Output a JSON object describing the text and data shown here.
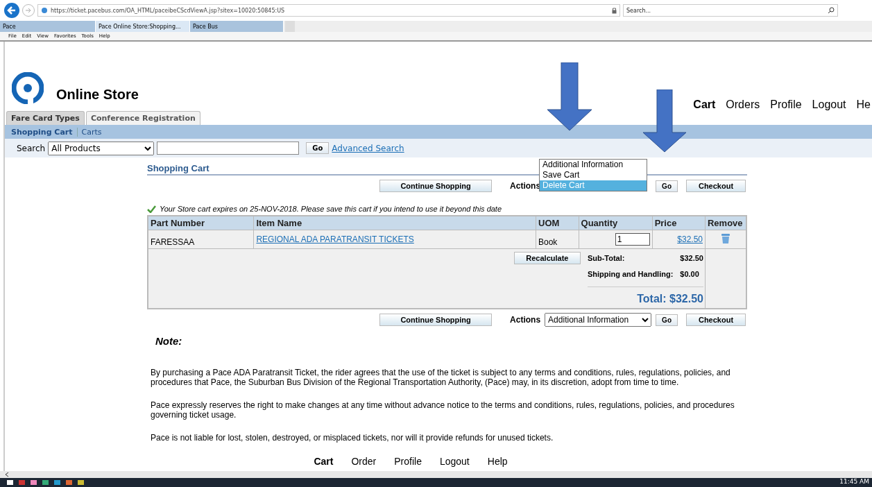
{
  "browser": {
    "url": "https://ticket.pacebus.com/OA_HTML/paceibeCScdViewA.jsp?sitex=10020:50845:US",
    "search_placeholder": "Search...",
    "tabs": [
      {
        "label": "Pace",
        "selected": false
      },
      {
        "label": "Pace Online Store:Shopping...",
        "selected": true
      },
      {
        "label": "Pace Bus",
        "selected": false
      }
    ],
    "menu": [
      "File",
      "Edit",
      "View",
      "Favorites",
      "Tools",
      "Help"
    ]
  },
  "header": {
    "title": "Online Store",
    "nav": [
      {
        "label": "Cart",
        "selected": true
      },
      {
        "label": "Orders",
        "selected": false
      },
      {
        "label": "Profile",
        "selected": false
      },
      {
        "label": "Logout",
        "selected": false
      },
      {
        "label": "He",
        "selected": false
      }
    ]
  },
  "tabs": [
    {
      "label": "Fare Card Types",
      "selected": true
    },
    {
      "label": "Conference Registration",
      "selected": false
    }
  ],
  "subtabs": [
    {
      "label": "Shopping Cart",
      "selected": true
    },
    {
      "label": "Carts",
      "selected": false
    }
  ],
  "search": {
    "label": "Search",
    "category": "All Products",
    "button": "Go",
    "advanced": "Advanced Search"
  },
  "cart": {
    "title": "Shopping Cart",
    "top_bar": {
      "continue": "Continue Shopping",
      "actions_label": "Actions",
      "go": "Go",
      "checkout": "Checkout"
    },
    "bottom_bar": {
      "continue": "Continue Shopping",
      "actions_label": "Actions",
      "go": "Go",
      "checkout": "Checkout"
    },
    "actions_menu": [
      {
        "label": "Additional Information",
        "selected": false
      },
      {
        "label": "Save Cart",
        "selected": false
      },
      {
        "label": "Delete Cart",
        "selected": true
      }
    ],
    "actions_bottom": "Additional Information",
    "expiry": "Your Store cart expires on 25-NOV-2018. Please save this cart if you intend to use it beyond this date",
    "columns": [
      "Part Number",
      "Item Name",
      "UOM",
      "Quantity",
      "Price",
      "Remove"
    ],
    "rows": [
      {
        "part": "FARESSAA",
        "item": "REGIONAL ADA PARATRANSIT TICKETS",
        "uom": "Book",
        "quantity": "1",
        "price": "$32.50"
      }
    ],
    "recalculate": "Recalculate",
    "subtotal_label": "Sub-Total:",
    "subtotal": "$32.50",
    "shipping_label": "Shipping and Handling:",
    "shipping": "$0.00",
    "total": "Total: $32.50"
  },
  "note": {
    "title": "Note:",
    "paragraphs": [
      "By purchasing a Pace ADA Paratransit Ticket, the rider agrees that the use of the ticket is subject to any terms and conditions, rules, regulations, policies, and procedures that Pace, the Suburban Bus Division of the Regional Transportation Authority, (Pace) may, in its discretion, adopt from time to time.",
      "Pace expressly reserves the right to make changes at any time without advance notice to the terms and conditions, rules, regulations, policies, and procedures governing ticket usage.",
      "Pace is not liable for lost, stolen, destroyed, or misplaced tickets, nor will it provide refunds for unused tickets."
    ]
  },
  "footer": [
    "Cart",
    "Order",
    "Profile",
    "Logout",
    "Help"
  ],
  "taskbar": {
    "time": "11:45 AM"
  }
}
